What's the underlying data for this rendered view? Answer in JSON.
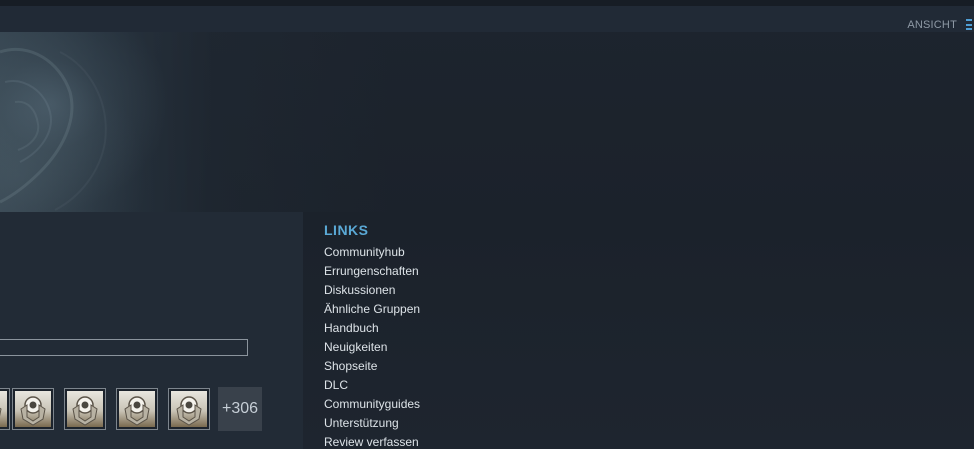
{
  "viewbar": {
    "label": "ANSICHT",
    "icon": "list-view-icon",
    "accent": "#4f9fd6"
  },
  "achievements": {
    "icon": "achievement-trophy-icon",
    "more_label": "+306"
  },
  "links": {
    "title": "LINKS",
    "title_color": "#5aa9d6",
    "items": [
      "Communityhub",
      "Errungenschaften",
      "Diskussionen",
      "Ähnliche Gruppen",
      "Handbuch",
      "Neuigkeiten",
      "Shopseite",
      "DLC",
      "Communityguides",
      "Unterstützung",
      "Review verfassen"
    ]
  }
}
